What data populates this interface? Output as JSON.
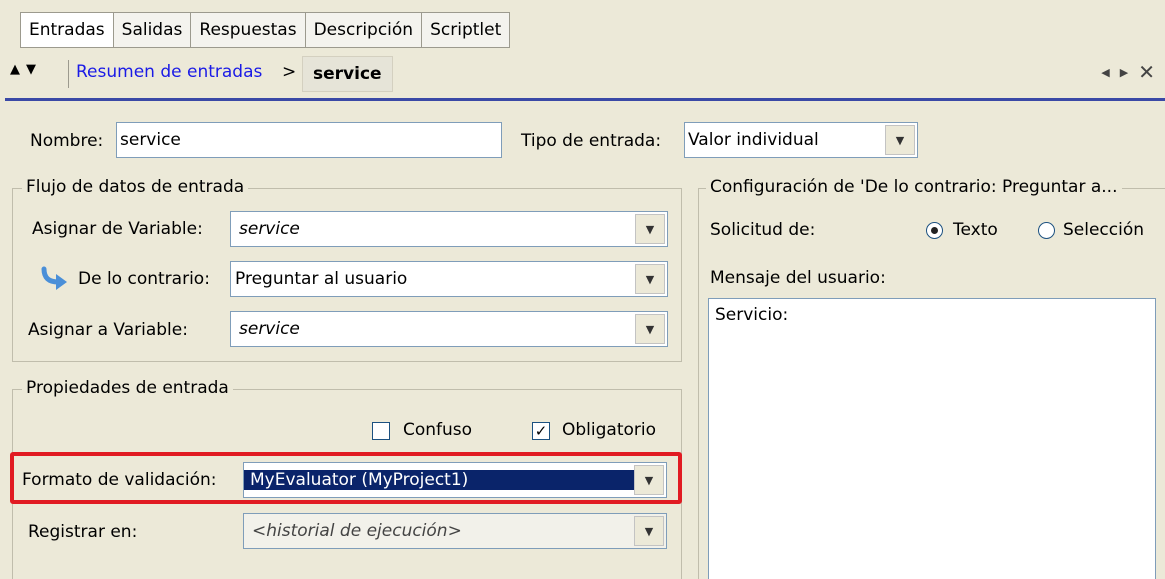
{
  "tabs": [
    "Entradas",
    "Salidas",
    "Respuestas",
    "Descripción",
    "Scriptlet"
  ],
  "breadcrumb": {
    "link": "Resumen de entradas",
    "separator": ">",
    "current": "service"
  },
  "form": {
    "nombre_label": "Nombre:",
    "nombre_value": "service",
    "tipo_label": "Tipo de entrada:",
    "tipo_value": "Valor individual"
  },
  "flujo": {
    "title": "Flujo de datos de entrada",
    "asignar_de_label": "Asignar de Variable:",
    "asignar_de_value": "service",
    "contrario_label": "De lo contrario:",
    "contrario_value": "Preguntar al usuario",
    "asignar_a_label": "Asignar a Variable:",
    "asignar_a_value": "service"
  },
  "propiedades": {
    "title": "Propiedades de entrada",
    "confuso_label": "Confuso",
    "confuso_checked": false,
    "obligatorio_label": "Obligatorio",
    "obligatorio_checked": true,
    "formato_label": "Formato de validación:",
    "formato_value": "MyEvaluator (MyProject1)",
    "registrar_label": "Registrar en:",
    "registrar_value": "<historial de ejecución>"
  },
  "config": {
    "title": "Configuración de 'De lo contrario: Preguntar a...",
    "solicitud_label": "Solicitud de:",
    "radio_texto": "Texto",
    "radio_seleccion": "Selección",
    "selected": "Texto",
    "mensaje_label": "Mensaje del usuario:",
    "mensaje_value": "Servicio:"
  },
  "colors": {
    "highlight": "#e11b22",
    "selection": "#0a246a",
    "link": "#1a1ae6"
  }
}
